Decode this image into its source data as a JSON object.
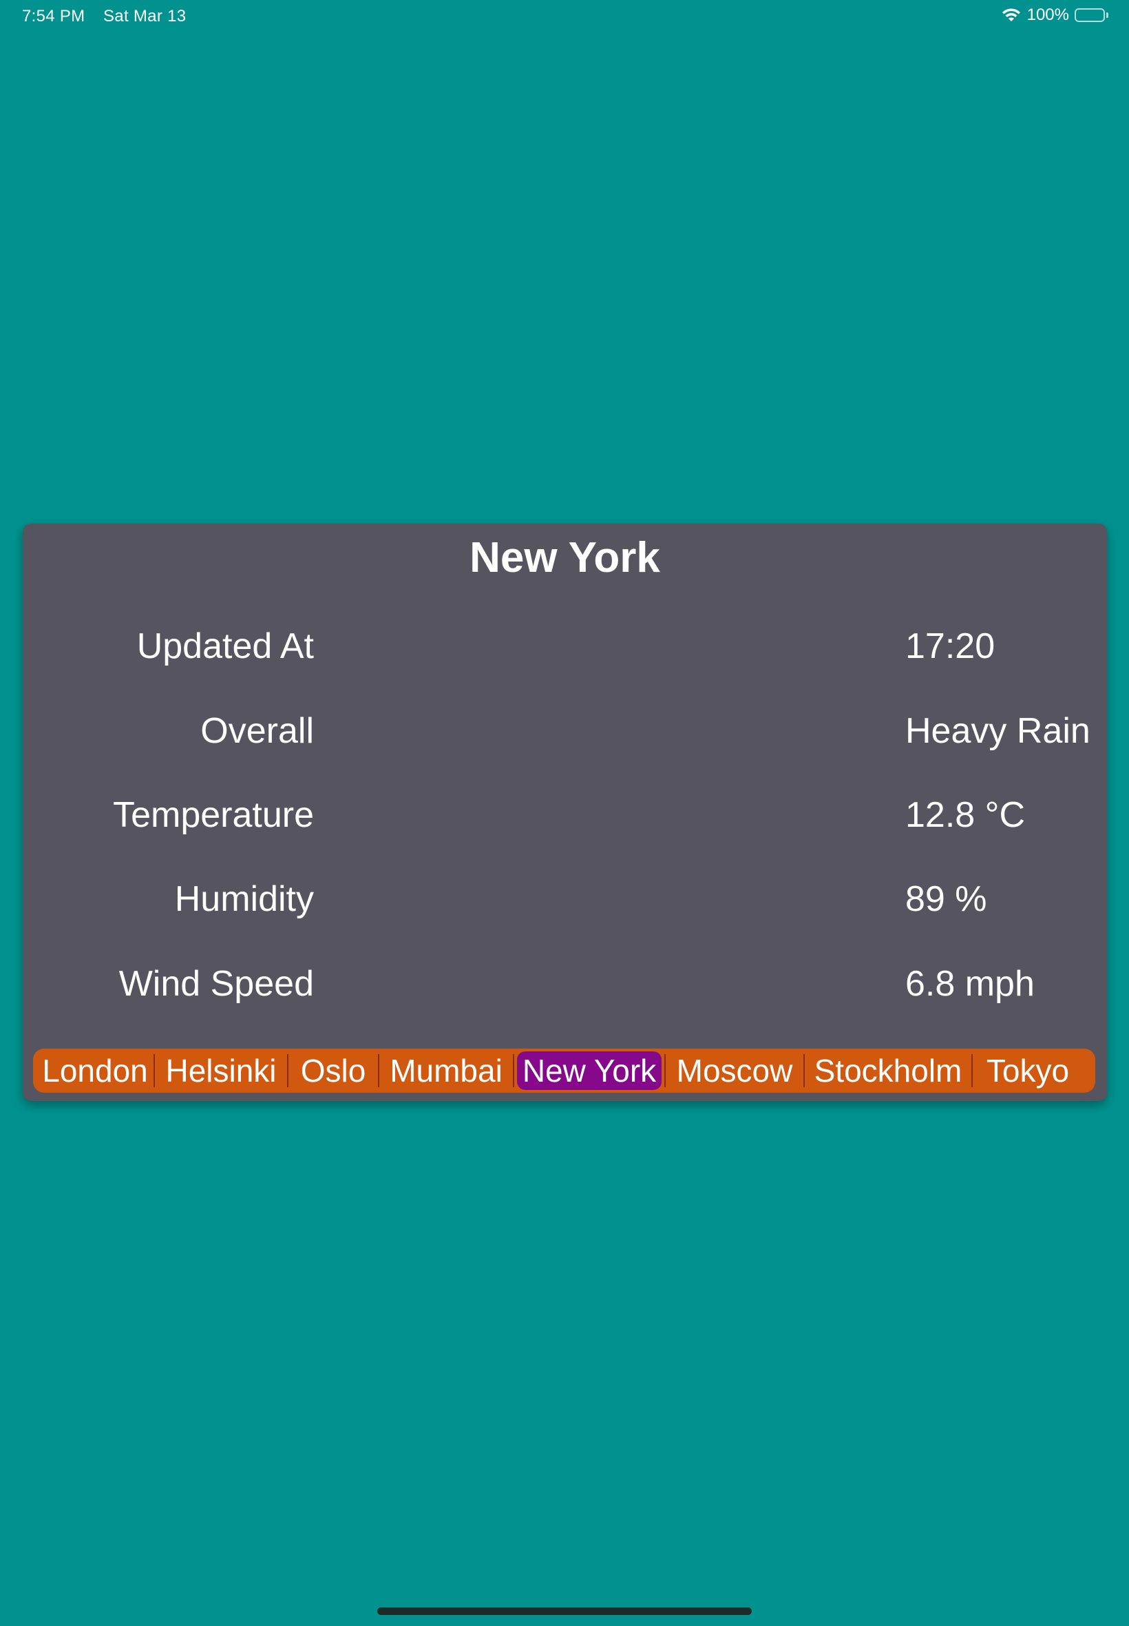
{
  "status_bar": {
    "time": "7:54 PM",
    "date": "Sat Mar 13",
    "battery_percent": "100%",
    "battery_level": 1.0,
    "icons": [
      "wifi-icon",
      "battery-icon"
    ]
  },
  "weather": {
    "city": "New York",
    "rows": [
      {
        "label": "Updated At",
        "value": "17:20"
      },
      {
        "label": "Overall",
        "value": "Heavy Rain"
      },
      {
        "label": "Temperature",
        "value": "12.8 °C"
      },
      {
        "label": "Humidity",
        "value": "89 %"
      },
      {
        "label": "Wind Speed",
        "value": "6.8 mph"
      }
    ]
  },
  "city_picker": {
    "selected": "New York",
    "options": [
      "London",
      "Helsinki",
      "Oslo",
      "Mumbai",
      "New York",
      "Moscow",
      "Stockholm",
      "Tokyo"
    ]
  },
  "colors": {
    "background": "#019290",
    "card": "#55545f",
    "segmented_background": "#d0580f",
    "segmented_selected": "#86088a"
  }
}
